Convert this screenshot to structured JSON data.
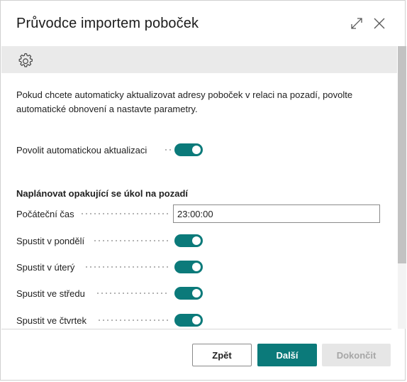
{
  "dialog": {
    "title": "Průvodce importem poboček",
    "expand_icon": "expand-diagonal-icon",
    "close_icon": "close-icon"
  },
  "toolbar": {
    "settings_icon": "gear-icon"
  },
  "content": {
    "intro": "Pokud chcete automaticky aktualizovat adresy poboček v relaci na pozadí, povolte automatické obnovení a nastavte parametry.",
    "auto_update": {
      "label": "Povolit automatickou aktualizaci",
      "enabled": true
    },
    "section_title": "Naplánovat opakující se úkol na pozadí",
    "start_time": {
      "label": "Počáteční čas",
      "value": "23:00:00"
    },
    "days": [
      {
        "label": "Spustit v pondělí",
        "enabled": true
      },
      {
        "label": "Spustit v úterý",
        "enabled": true
      },
      {
        "label": "Spustit ve středu",
        "enabled": true
      },
      {
        "label": "Spustit ve čtvrtek",
        "enabled": true
      }
    ]
  },
  "footer": {
    "back_label": "Zpět",
    "next_label": "Další",
    "finish_label": "Dokončit"
  },
  "colors": {
    "accent": "#0b7a7a",
    "toolbar_bg": "#eaeaea",
    "disabled_bg": "#e6e6e6"
  }
}
